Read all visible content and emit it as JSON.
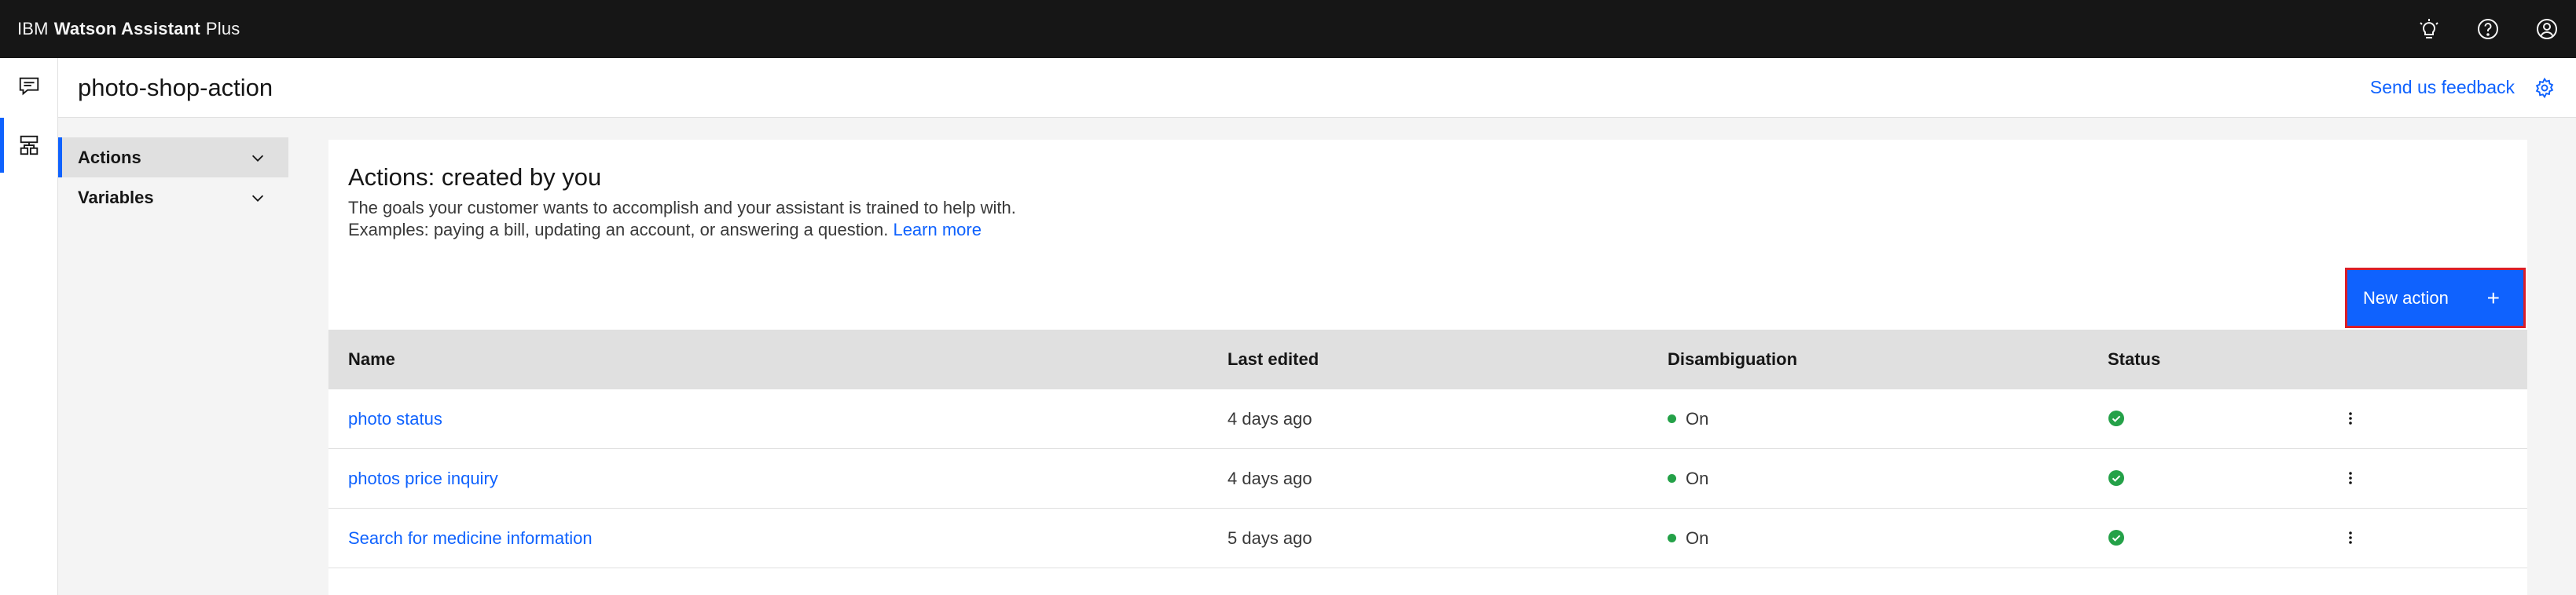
{
  "topbar": {
    "brand_prefix": "IBM",
    "brand_name": "Watson Assistant",
    "brand_suffix": "Plus",
    "icons": [
      "lightbulb-icon",
      "help-icon",
      "user-avatar-icon"
    ]
  },
  "rail": {
    "items": [
      {
        "icon": "chat-icon",
        "active": false
      },
      {
        "icon": "actions-icon",
        "active": true
      }
    ]
  },
  "header": {
    "title": "photo-shop-action",
    "feedback_label": "Send us feedback",
    "settings_icon": "gear-icon"
  },
  "sidenav": {
    "items": [
      {
        "label": "Actions",
        "active": true
      },
      {
        "label": "Variables",
        "active": false
      }
    ]
  },
  "main": {
    "title": "Actions: created by you",
    "description_line1": "The goals your customer wants to accomplish and your assistant is trained to help with.",
    "description_line2": "Examples: paying a bill, updating an account, or answering a question.",
    "learn_more": "Learn more",
    "new_action_label": "New action",
    "new_action_icon": "+",
    "table": {
      "columns": [
        "Name",
        "Last edited",
        "Disambiguation",
        "Status"
      ],
      "rows": [
        {
          "name": "photo status",
          "last_edited": "4 days ago",
          "disambiguation": "On"
        },
        {
          "name": "photos price inquiry",
          "last_edited": "4 days ago",
          "disambiguation": "On"
        },
        {
          "name": "Search for medicine information",
          "last_edited": "5 days ago",
          "disambiguation": "On"
        }
      ]
    }
  },
  "colors": {
    "accent": "#0f62fe",
    "topbar": "#161616",
    "status_ok": "#24a148",
    "highlight_border": "#da1e28"
  }
}
